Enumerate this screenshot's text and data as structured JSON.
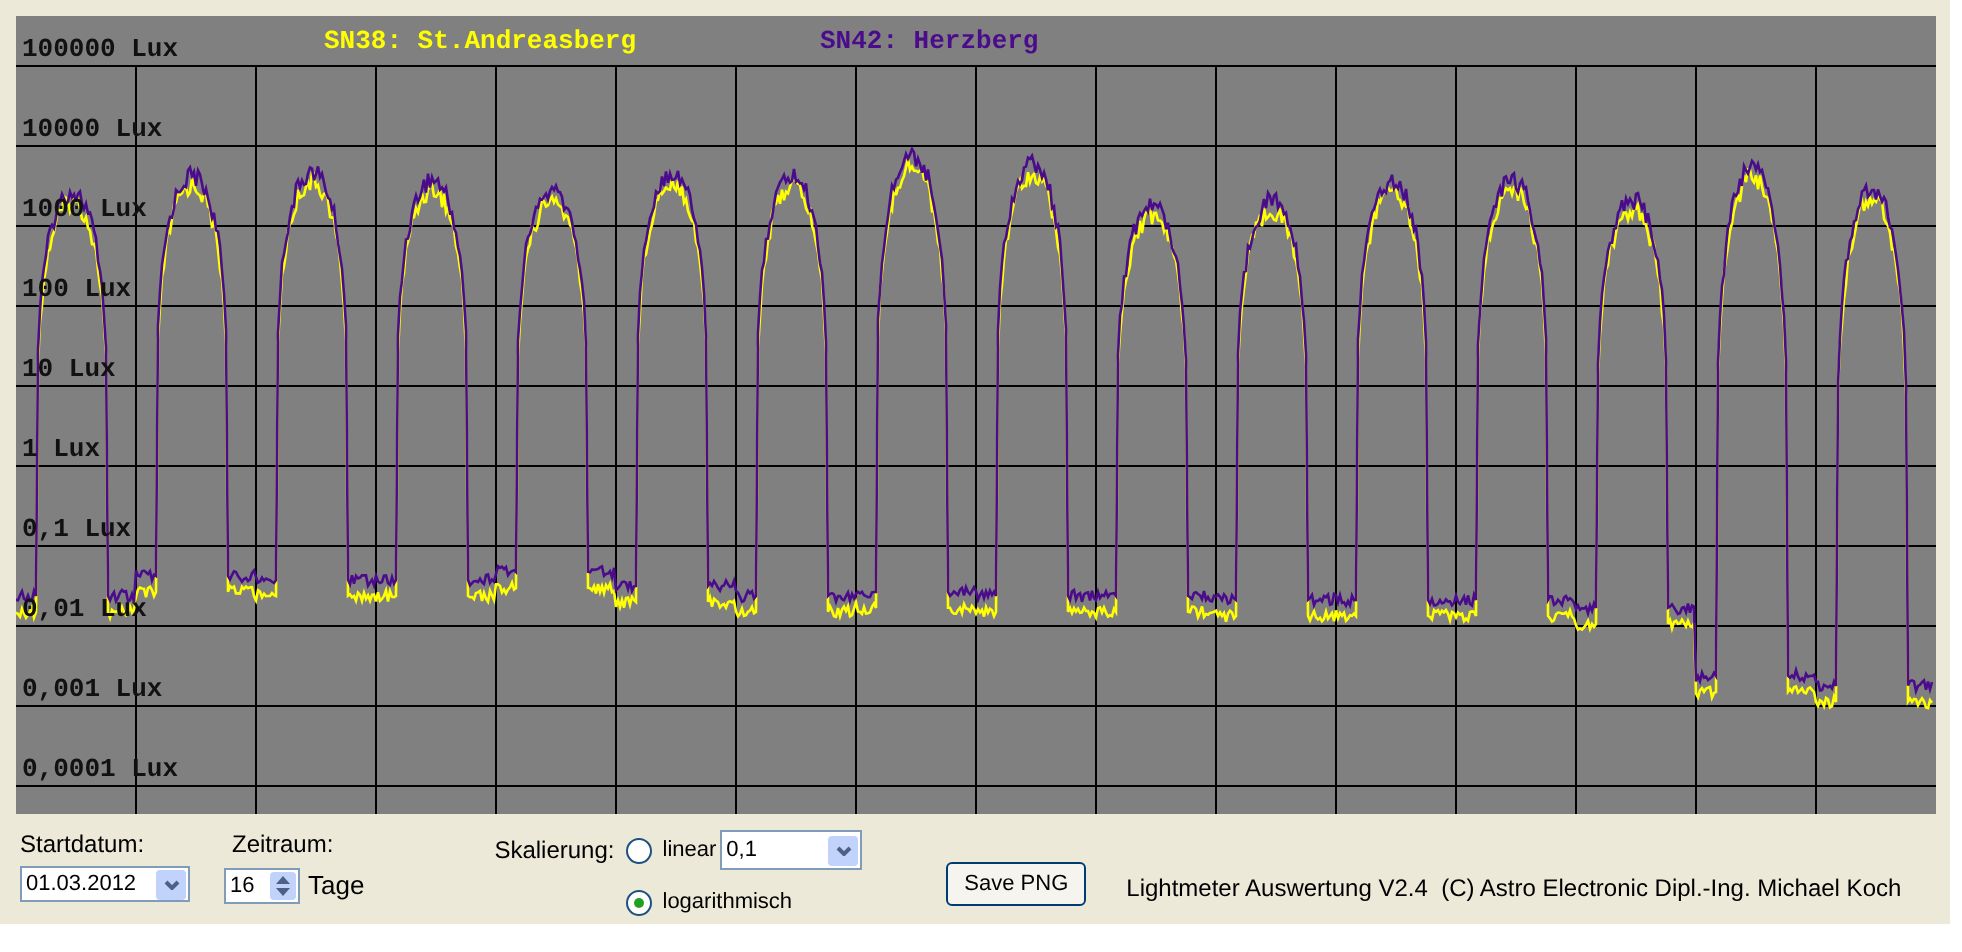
{
  "chart": {
    "legend": [
      {
        "label": "SN38: St.Andreasberg",
        "color": "#ffff00"
      },
      {
        "label": "SN42: Herzberg",
        "color": "#4b0c8c"
      }
    ],
    "y_labels": [
      "100000 Lux",
      "10000 Lux",
      "1000 Lux",
      "100 Lux",
      "10 Lux",
      "1 Lux",
      "0,1 Lux",
      "0,01 Lux",
      "0,001 Lux",
      "0,0001 Lux"
    ]
  },
  "controls": {
    "start_date": {
      "label": "Startdatum:",
      "value": "01.03.2012"
    },
    "period": {
      "label": "Zeitraum:",
      "value": "16",
      "unit": "Tage"
    },
    "scaling": {
      "label": "Skalierung:",
      "options": [
        {
          "label": "linear",
          "selected": false
        },
        {
          "label": "logarithmisch",
          "selected": true
        }
      ],
      "linear_value": "0,1"
    },
    "save_button": "Save PNG"
  },
  "footer": "Lightmeter Auswertung V2.4  (C) Astro Electronic Dipl.-Ing. Michael Koch"
}
